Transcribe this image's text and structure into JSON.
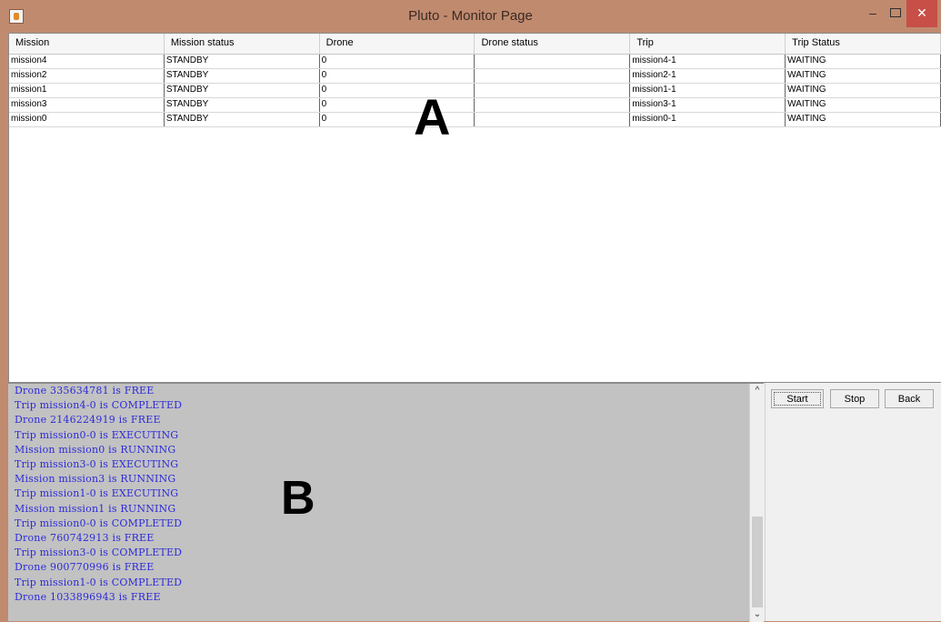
{
  "window": {
    "title": "Pluto - Monitor Page",
    "icons": {
      "app": "java-icon",
      "minimize": "minimize-icon",
      "maximize": "maximize-icon",
      "close": "close-icon"
    },
    "min_label": "–",
    "close_label": "✕"
  },
  "table": {
    "headers": [
      "Mission",
      "Mission status",
      "Drone",
      "Drone status",
      "Trip",
      "Trip Status"
    ],
    "rows": [
      [
        "mission4",
        "STANDBY",
        "0",
        "",
        "mission4-1",
        "WAITING"
      ],
      [
        "mission2",
        "STANDBY",
        "0",
        "",
        "mission2-1",
        "WAITING"
      ],
      [
        "mission1",
        "STANDBY",
        "0",
        "",
        "mission1-1",
        "WAITING"
      ],
      [
        "mission3",
        "STANDBY",
        "0",
        "",
        "mission3-1",
        "WAITING"
      ],
      [
        "mission0",
        "STANDBY",
        "0",
        "",
        "mission0-1",
        "WAITING"
      ]
    ],
    "overlay_label": "A"
  },
  "log": {
    "lines": [
      "Drone 335634781 is FREE",
      "Trip mission4-0 is COMPLETED",
      "Drone 2146224919 is FREE",
      "Trip mission0-0 is EXECUTING",
      "Mission mission0 is RUNNING",
      "Trip mission3-0 is EXECUTING",
      "Mission mission3 is RUNNING",
      "Trip mission1-0 is EXECUTING",
      "Mission mission1 is RUNNING",
      "Trip mission0-0 is COMPLETED",
      "Drone 760742913 is FREE",
      "Trip mission3-0 is COMPLETED",
      "Drone 900770996 is FREE",
      "Trip mission1-0 is COMPLETED",
      "Drone 1033896943 is FREE"
    ],
    "overlay_label": "B",
    "scroll_up": "^",
    "scroll_down": "⌄"
  },
  "buttons": {
    "start": "Start",
    "stop": "Stop",
    "back": "Back"
  },
  "colors": {
    "title_bar": "#c08a6f",
    "log_text": "#2d2bd8",
    "close_button": "#c74f47"
  }
}
